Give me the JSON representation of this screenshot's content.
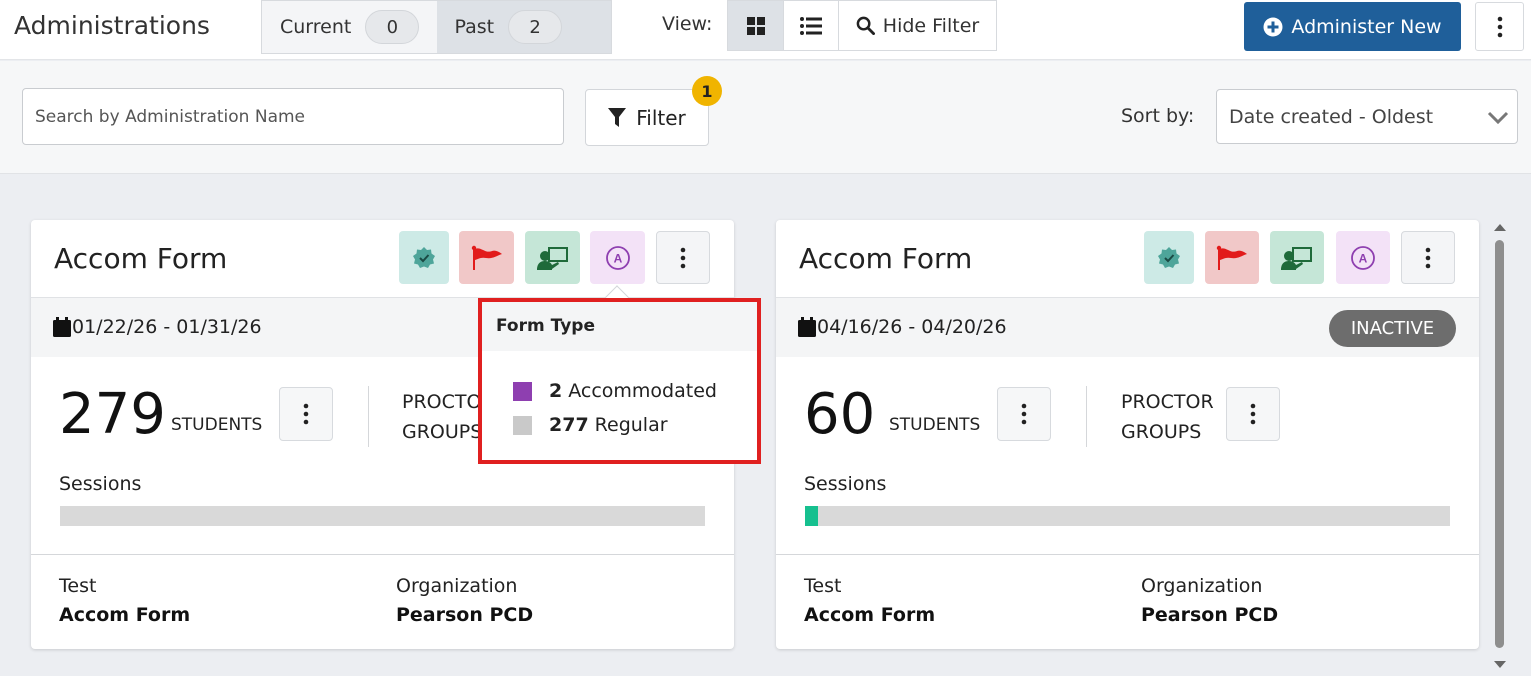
{
  "header": {
    "title": "Administrations",
    "tabs": [
      {
        "label": "Current",
        "count": "0"
      },
      {
        "label": "Past",
        "count": "2"
      }
    ],
    "view_label": "View:",
    "hide_filter_label": "Hide Filter",
    "administer_new_label": "Administer New"
  },
  "filters": {
    "search_placeholder": "Search by Administration Name",
    "filter_label": "Filter",
    "filter_count": "1",
    "sort_label": "Sort by:",
    "sort_value": "Date created - Oldest"
  },
  "cards": [
    {
      "title": "Accom Form",
      "date_range": "01/22/26 - 01/31/26",
      "students_count": "279",
      "students_label": "STUDENTS",
      "proctor_label_line1": "PROCTOR",
      "proctor_label_line2": "GROUPS",
      "sessions_label": "Sessions",
      "sessions_progress": 0,
      "test_label": "Test",
      "test_value": "Accom Form",
      "org_label": "Organization",
      "org_value": "Pearson PCD"
    },
    {
      "title": "Accom Form",
      "date_range": "04/16/26 - 04/20/26",
      "status": "INACTIVE",
      "students_count": "60",
      "students_label": "STUDENTS",
      "proctor_label_line1": "PROCTOR",
      "proctor_label_line2": "GROUPS",
      "sessions_label": "Sessions",
      "sessions_progress": 0.02,
      "test_label": "Test",
      "test_value": "Accom Form",
      "org_label": "Organization",
      "org_value": "Pearson PCD"
    }
  ],
  "form_type_popover": {
    "title": "Form Type",
    "rows": [
      {
        "count": "2",
        "label": "Accommodated",
        "color": "#8e3fb0"
      },
      {
        "count": "277",
        "label": "Regular",
        "color": "#c9c9c9"
      }
    ]
  },
  "colors": {
    "primary": "#1f5f9a",
    "badge": "#f0b400",
    "progress": "#16c08f",
    "inactive": "#6d6d6d",
    "highlight": "#e02020"
  },
  "icons": [
    "grid-view-icon",
    "list-view-icon",
    "search-icon",
    "plus-circle-icon",
    "kebab-icon",
    "filter-funnel-icon",
    "chevron-down-icon",
    "certificate-icon",
    "flag-icon",
    "proctor-icon",
    "accommodation-icon",
    "calendar-icon"
  ]
}
